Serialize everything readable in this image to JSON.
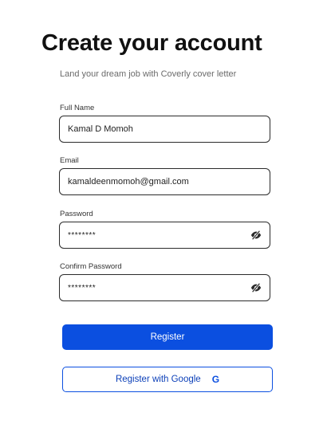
{
  "header": {
    "title": "Create your account",
    "subtitle": "Land your dream job with Coverly cover letter"
  },
  "form": {
    "full_name": {
      "label": "Full Name",
      "value": "Kamal D Momoh"
    },
    "email": {
      "label": "Email",
      "value": "kamaldeenmomoh@gmail.com"
    },
    "password": {
      "label": "Password",
      "value": "********",
      "toggle_icon": "eye-slash-icon"
    },
    "confirm_password": {
      "label": "Confirm Password",
      "value": "********",
      "toggle_icon": "eye-slash-icon"
    }
  },
  "actions": {
    "register_label": "Register",
    "google_label": "Register with Google",
    "google_icon_glyph": "G"
  },
  "colors": {
    "primary": "#0b4fe0",
    "text": "#111111",
    "subtle_text": "#6b6b6b",
    "border": "#2b2b2b"
  }
}
